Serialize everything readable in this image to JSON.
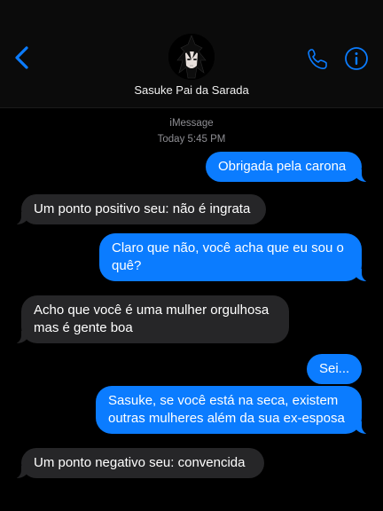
{
  "header": {
    "contact_name": "Sasuke Pai da Sarada",
    "back_icon": "chevron-left-icon",
    "call_icon": "phone-icon",
    "info_icon": "info-icon",
    "accent_color": "#0b7cff"
  },
  "conversation": {
    "service": "iMessage",
    "timestamp": "Today 5:45 PM",
    "messages": [
      {
        "direction": "sent",
        "text": "Obrigada pela carona"
      },
      {
        "direction": "received",
        "text": "Um ponto positivo seu: não é ingrata"
      },
      {
        "direction": "sent",
        "text": "Claro que não, você acha que eu sou o quê?"
      },
      {
        "direction": "received",
        "text": "Acho que você é uma mulher orgulhosa mas é gente boa"
      },
      {
        "direction": "sent",
        "text": "Sei..."
      },
      {
        "direction": "sent",
        "text": "Sasuke, se você está na seca, existem outras mulheres além da sua ex-esposa"
      },
      {
        "direction": "received",
        "text": "Um ponto negativo seu: convencida"
      }
    ]
  }
}
